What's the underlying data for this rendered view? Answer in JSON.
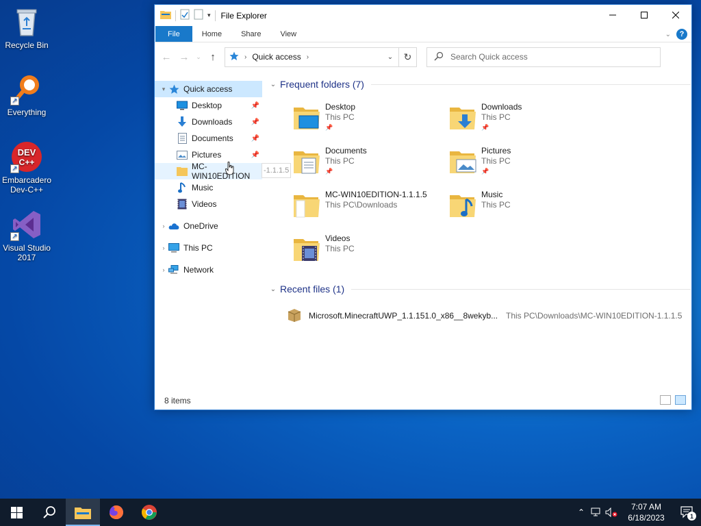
{
  "desktop": {
    "icons": [
      {
        "label": "Recycle Bin"
      },
      {
        "label": "Everything"
      },
      {
        "label": "Embarcadero Dev-C++",
        "logo_text_1": "DEV",
        "logo_text_2": "C++"
      },
      {
        "label": "Visual Studio 2017"
      }
    ]
  },
  "window": {
    "title": "File Explorer",
    "ribbon_tabs": [
      "File",
      "Home",
      "Share",
      "View"
    ],
    "address": {
      "location": "Quick access"
    },
    "search": {
      "placeholder": "Search Quick access"
    },
    "nav": {
      "quick_access": "Quick access",
      "items": [
        "Desktop",
        "Downloads",
        "Documents",
        "Pictures",
        "MC-WIN10EDITION",
        "Music",
        "Videos"
      ],
      "drag_ghost_text": "-1.1.1.5",
      "onedrive": "OneDrive",
      "this_pc": "This PC",
      "network": "Network"
    },
    "frequent": {
      "header": "Frequent folders (7)",
      "folders": [
        {
          "name": "Desktop",
          "location": "This PC",
          "pinned": true,
          "icon": "desktop-folder-icon"
        },
        {
          "name": "Downloads",
          "location": "This PC",
          "pinned": true,
          "icon": "downloads-folder-icon"
        },
        {
          "name": "Documents",
          "location": "This PC",
          "pinned": true,
          "icon": "documents-folder-icon"
        },
        {
          "name": "Pictures",
          "location": "This PC",
          "pinned": true,
          "icon": "pictures-folder-icon"
        },
        {
          "name": "MC-WIN10EDITION-1.1.1.5",
          "location": "This PC\\Downloads",
          "pinned": false,
          "icon": "folder-icon"
        },
        {
          "name": "Music",
          "location": "This PC",
          "pinned": false,
          "icon": "music-folder-icon"
        },
        {
          "name": "Videos",
          "location": "This PC",
          "pinned": false,
          "icon": "videos-folder-icon"
        }
      ]
    },
    "recent": {
      "header": "Recent files (1)",
      "files": [
        {
          "name": "Microsoft.MinecraftUWP_1.1.151.0_x86__8wekyb...",
          "path": "This PC\\Downloads\\MC-WIN10EDITION-1.1.1.5"
        }
      ]
    },
    "status": {
      "item_count": "8 items"
    }
  },
  "taskbar": {
    "clock_time": "7:07 AM",
    "clock_date": "6/18/2023",
    "notification_count": "1"
  },
  "colors": {
    "accent": "#1979ca",
    "selection": "#cce8ff",
    "group_header": "#1e3287",
    "folder_yellow": "#f5c65a"
  }
}
